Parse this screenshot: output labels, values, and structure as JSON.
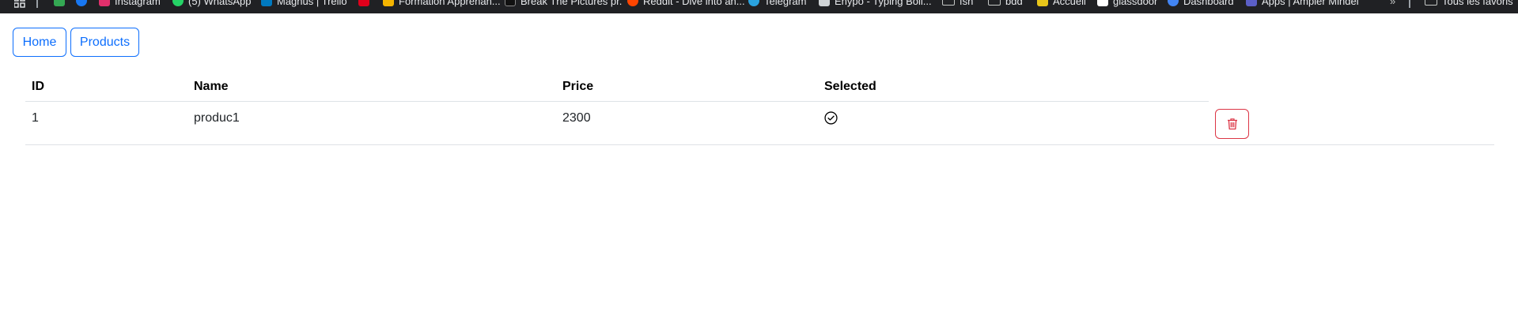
{
  "bookmarks": [
    {
      "label": "Instagram",
      "icon": "instagram-icon",
      "color": "#e1306c"
    },
    {
      "label": "(5) WhatsApp",
      "icon": "whatsapp-icon",
      "color": "#25d366"
    },
    {
      "label": "Magnus | Trello",
      "icon": "trello-icon",
      "color": "#0079bf"
    },
    {
      "label": "",
      "icon": "red-square-icon",
      "color": "#e0001b"
    },
    {
      "label": "Formation Apprenan...",
      "icon": "formation-icon",
      "color": "#f4b400"
    },
    {
      "label": "Break The Pictures pr.",
      "icon": "break-icon",
      "color": "#111111"
    },
    {
      "label": "Reddit - Dive into an...",
      "icon": "reddit-icon",
      "color": "#ff4500"
    },
    {
      "label": "Telegram",
      "icon": "telegram-icon",
      "color": "#2aa3df"
    },
    {
      "label": "Enypo - Typing Boll...",
      "icon": "typing-icon",
      "color": "#cfd3d6"
    },
    {
      "label": "fsh",
      "icon": "folder-icon",
      "color": "#c4c7c5"
    },
    {
      "label": "bdd",
      "icon": "folder-icon",
      "color": "#c4c7c5"
    },
    {
      "label": "Accueil",
      "icon": "accueil-icon",
      "color": "#e8c61a"
    },
    {
      "label": "glassdoor",
      "icon": "glassdoor-icon",
      "color": "#ffffff"
    },
    {
      "label": "Dashboard",
      "icon": "dashboard-icon",
      "color": "#4285f4"
    },
    {
      "label": "Apps | Ampler Mindel",
      "icon": "apps-ampler-icon",
      "color": "#5b5fc7"
    },
    {
      "label": "Tous les favoris",
      "icon": "all-bookmarks-icon",
      "color": "#c4c7c5"
    }
  ],
  "nav": {
    "home_label": "Home",
    "products_label": "Products"
  },
  "table": {
    "columns": [
      "ID",
      "Name",
      "Price",
      "Selected"
    ],
    "rows": [
      {
        "id": "1",
        "name": "produc1",
        "price": "2300",
        "selected": true
      }
    ]
  },
  "colors": {
    "primary": "#0d6efd",
    "danger": "#dc3545",
    "bookmarks_bg": "#202124"
  }
}
